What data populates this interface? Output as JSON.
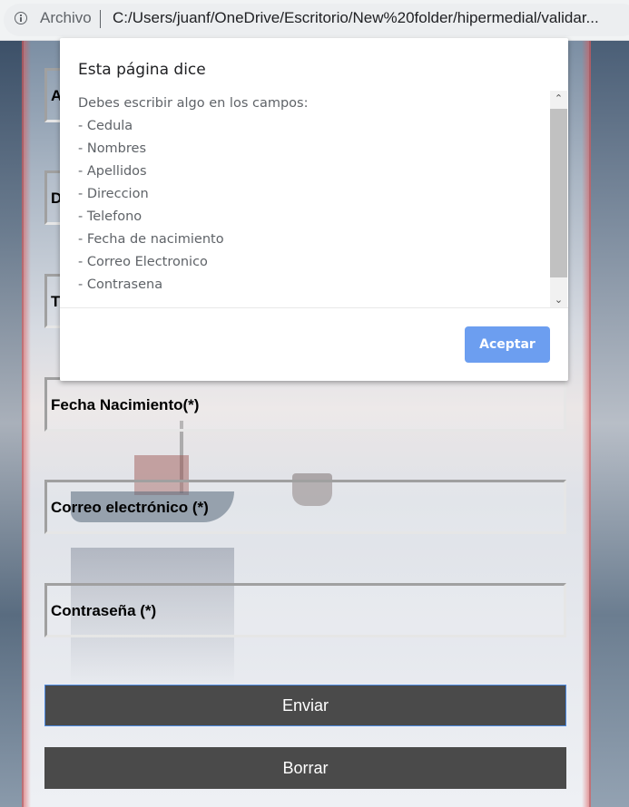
{
  "browser": {
    "protocol_label": "Archivo",
    "url": "C:/Users/juanf/OneDrive/Escritorio/New%20folder/hipermedial/validar..."
  },
  "form": {
    "fields": [
      {
        "label": "A"
      },
      {
        "label": "D"
      },
      {
        "label": "T"
      },
      {
        "label": "Fecha Nacimiento(*)"
      },
      {
        "label": "Correo electrónico (*)"
      },
      {
        "label": "Contraseña (*)"
      }
    ],
    "submit_label": "Enviar",
    "reset_label": "Borrar"
  },
  "dialog": {
    "title": "Esta página dice",
    "lines": [
      "Debes escribir algo en los campos:",
      "- Cedula",
      "- Nombres",
      "- Apellidos",
      "- Direccion",
      "- Telefono",
      "- Fecha de nacimiento",
      "- Correo Electronico",
      "- Contrasena"
    ],
    "ok_label": "Aceptar"
  },
  "colors": {
    "button_bg": "#4a4a4a",
    "ok_button_bg": "#6c9ef0",
    "focus_border": "#4d8ae0"
  }
}
